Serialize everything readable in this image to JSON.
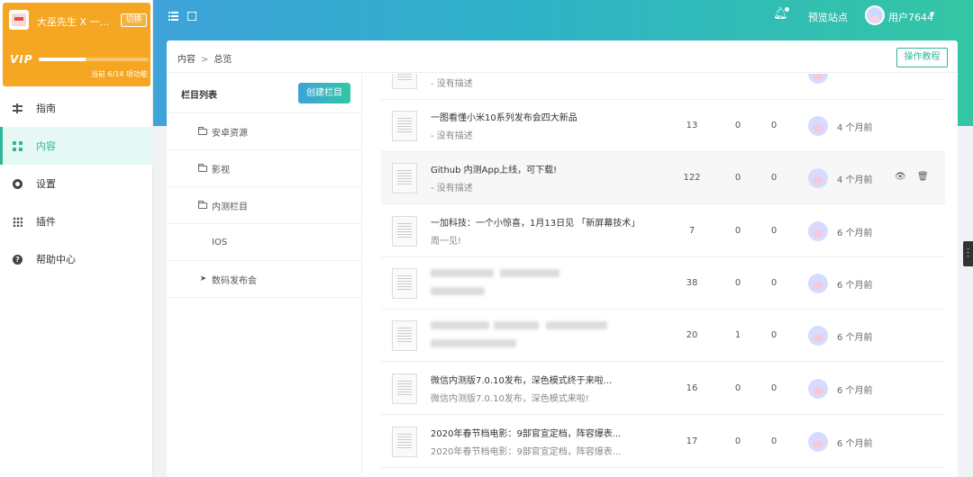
{
  "brand": {
    "name": "大巫先生 X 一枚...",
    "switch_label": "切换",
    "vip_label": "VIP",
    "progress_text": "当前 6/14 项功能",
    "progress_fraction": 0.43
  },
  "nav": [
    {
      "label": "指南",
      "icon": "guide-icon",
      "active": false
    },
    {
      "label": "内容",
      "icon": "grid-icon",
      "active": true
    },
    {
      "label": "设置",
      "icon": "gear-icon",
      "active": false
    },
    {
      "label": "插件",
      "icon": "apps-icon",
      "active": false
    },
    {
      "label": "帮助中心",
      "icon": "help-icon",
      "active": false
    }
  ],
  "topbar": {
    "preview_label": "预览站点",
    "username": "用户7644"
  },
  "breadcrumb": {
    "root": "内容",
    "sep": ">",
    "current": "总览"
  },
  "tutorial_label": "操作教程",
  "columns": {
    "title": "栏目列表",
    "create_label": "创建栏目",
    "items": [
      {
        "label": "安卓资源",
        "icon": "folder-icon"
      },
      {
        "label": "影视",
        "icon": "folder-icon"
      },
      {
        "label": "内测栏目",
        "icon": "folder-icon"
      },
      {
        "label": "IOS",
        "icon": "apple-icon"
      },
      {
        "label": "数码发布会",
        "icon": "send-icon"
      }
    ]
  },
  "articles": [
    {
      "title": "",
      "desc": "- 没有描述",
      "views": "",
      "c1": "",
      "c2": "",
      "time": ""
    },
    {
      "title": "一图看懂小米10系列发布会四大新品",
      "desc": "- 没有描述",
      "views": "13",
      "c1": "0",
      "c2": "0",
      "time": "4 个月前"
    },
    {
      "title": "Github 内测App上线，可下载!",
      "desc": "- 没有描述",
      "views": "122",
      "c1": "0",
      "c2": "0",
      "time": "4 个月前"
    },
    {
      "title": "一加科技：一个小惊喜，1月13日见 「新屏幕技术」",
      "desc": "周一见!",
      "views": "7",
      "c1": "0",
      "c2": "0",
      "time": "6 个月前"
    },
    {
      "title": "",
      "desc": "",
      "views": "38",
      "c1": "0",
      "c2": "0",
      "time": "6 个月前"
    },
    {
      "title": "",
      "desc": "",
      "views": "20",
      "c1": "1",
      "c2": "0",
      "time": "6 个月前"
    },
    {
      "title": "微信内测版7.0.10发布，深色模式终于来啦...",
      "desc": "微信内测版7.0.10发布，深色模式来啦!",
      "views": "16",
      "c1": "0",
      "c2": "0",
      "time": "6 个月前"
    },
    {
      "title": "2020年春节档电影：9部官宣定档，阵容爆表...",
      "desc": "2020年春节档电影：9部官宣定档，阵容爆表...",
      "views": "17",
      "c1": "0",
      "c2": "0",
      "time": "6 个月前"
    }
  ],
  "colors": {
    "accent": "#2fb79a",
    "brand_bg": "#f5a623",
    "header_from": "#3ea3d9",
    "header_to": "#33c6a4"
  }
}
